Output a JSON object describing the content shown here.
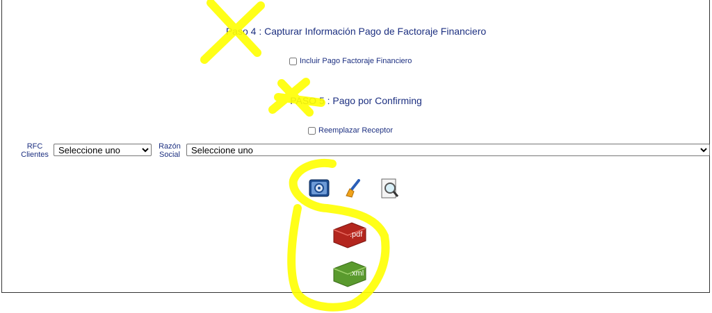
{
  "step4": {
    "title": "Paso 4 : Capturar Información Pago de Factoraje Financiero",
    "checkbox_label": "Incluir Pago Factoraje Financiero"
  },
  "step5": {
    "title": "PASO 5 : Pago por Confirming",
    "checkbox_label": "Reemplazar Receptor"
  },
  "filters": {
    "rfc_label_line1": "RFC",
    "rfc_label_line2": "Clientes",
    "rfc_select": "Seleccione uno",
    "razon_label_line1": "Razón",
    "razon_label_line2": "Social",
    "razon_select": "Seleccione uno"
  },
  "icons": [
    "generate-icon",
    "broom-icon",
    "preview-icon",
    "pdf-icon",
    "xml-icon"
  ],
  "file_labels": {
    "pdf": ".pdf",
    "xml": ".xml"
  },
  "colors": {
    "text": "#1c2f80",
    "highlight": "#ffff00",
    "pdf": "#b3261e",
    "xml": "#5a9a2e"
  }
}
